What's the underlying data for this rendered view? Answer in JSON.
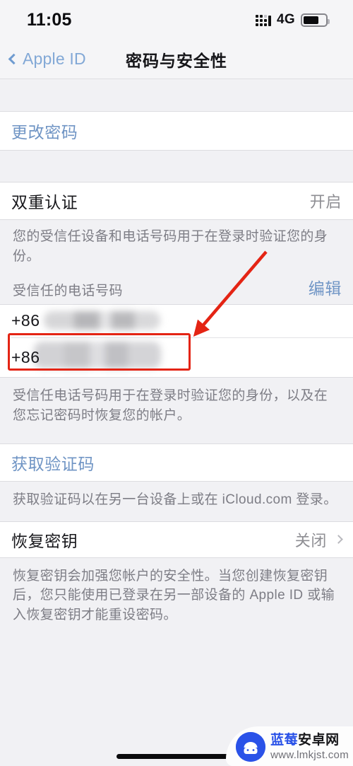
{
  "status_bar": {
    "time": "11:05",
    "network": "4G",
    "signal_icon": "signal-dots-icon",
    "battery_icon": "battery-icon",
    "battery_level_percent": 70
  },
  "nav_bar": {
    "back_icon": "chevron-left-icon",
    "back_label": "Apple ID",
    "title": "密码与安全性"
  },
  "sections": {
    "change_password": {
      "label": "更改密码"
    },
    "two_factor": {
      "label": "双重认证",
      "value": "开启",
      "footer": "您的受信任设备和电话号码用于在登录时验证您的身份。"
    },
    "trusted_numbers": {
      "header": "受信任的电话号码",
      "edit_label": "编辑",
      "rows": [
        {
          "prefix": "+86",
          "number_masked": ""
        },
        {
          "prefix": "+86",
          "number_masked": ""
        }
      ],
      "footer": "受信任电话号码用于在登录时验证您的身份，以及在您忘记密码时恢复您的帐户。"
    },
    "verification_code": {
      "label": "获取验证码",
      "footer": "获取验证码以在另一台设备上或在 iCloud.com 登录。"
    },
    "recovery_key": {
      "label": "恢复密钥",
      "value": "关闭",
      "chevron_icon": "chevron-right-icon",
      "footer": "恢复密钥会加强您帐户的安全性。当您创建恢复密钥后，您只能使用已登录在另一部设备的 Apple ID 或输入恢复密钥才能重设密码。"
    }
  },
  "annotations": {
    "highlight_color": "#e42414",
    "highlight_target": "second-trusted-phone-row",
    "arrow_icon": "red-arrow-icon"
  },
  "watermark": {
    "site_name_part1": "蓝莓",
    "site_name_part2": "安卓网",
    "url": "www.lmkjst.com",
    "logo_icon": "blueberry-android-logo-icon",
    "brand_color": "#2a52e8"
  },
  "home_indicator": {
    "icon": "home-indicator-bar"
  }
}
